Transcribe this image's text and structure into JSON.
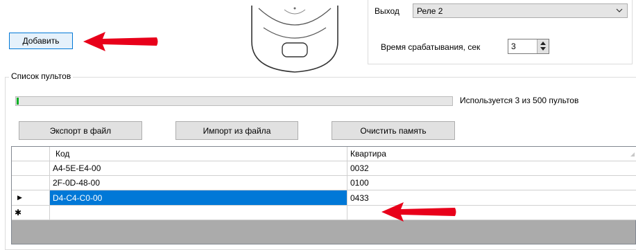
{
  "add_button_label": "Добавить",
  "output_label": "Выход",
  "output_select_value": "Реле 2",
  "trigger_time_label": "Время срабатывания, сек",
  "trigger_time_value": "3",
  "remotes_group_title": "Список пультов",
  "usage_text": "Используется 3 из 500 пультов",
  "usage_fraction": 0.006,
  "buttons": {
    "export": "Экспорт в файл",
    "import": "Импорт из файла",
    "clear": "Очистить память"
  },
  "grid": {
    "columns": [
      "Код",
      "Квартира"
    ],
    "rows": [
      {
        "code": "A4-5E-E4-00",
        "apartment": "0032",
        "marker": ""
      },
      {
        "code": "2F-0D-48-00",
        "apartment": "0100",
        "marker": ""
      },
      {
        "code": "D4-C4-C0-00",
        "apartment": "0433",
        "marker": "▶"
      }
    ],
    "new_row_marker": "✱"
  },
  "colors": {
    "selection": "#0078d7",
    "arrow": "#e8001a",
    "progress": "#06b025"
  }
}
